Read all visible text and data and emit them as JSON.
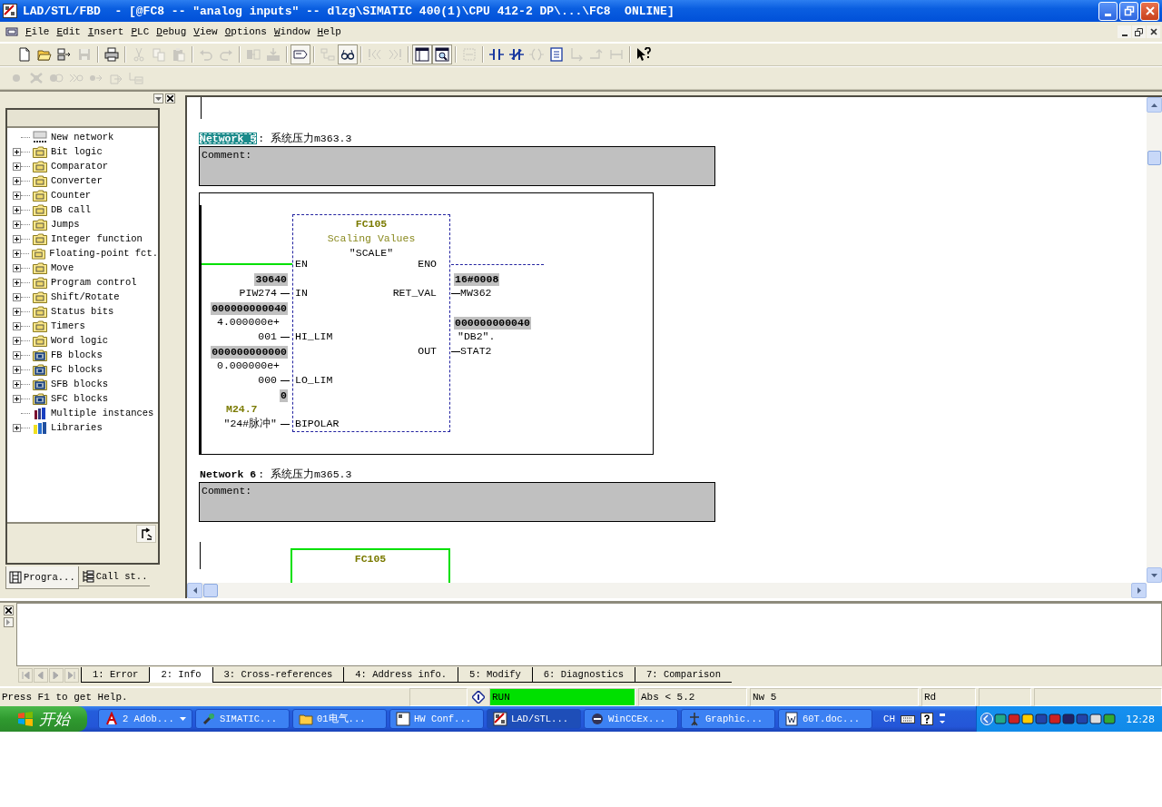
{
  "window": {
    "title": "LAD/STL/FBD  - [@FC8 -- ″analog inputs″ -- dlzg\\SIMATIC 400(1)\\CPU 412-2 DP\\...\\FC8  ONLINE]"
  },
  "menu": [
    "File",
    "Edit",
    "Insert",
    "PLC",
    "Debug",
    "View",
    "Options",
    "Window",
    "Help"
  ],
  "toolbar": [
    {
      "kind": "new",
      "disabled": false,
      "pressed": false
    },
    {
      "kind": "open",
      "disabled": false,
      "pressed": false
    },
    {
      "kind": "nodes",
      "disabled": false,
      "pressed": false
    },
    {
      "kind": "save",
      "disabled": true,
      "pressed": false
    },
    {
      "kind": "separator"
    },
    {
      "kind": "print",
      "disabled": false,
      "pressed": false
    },
    {
      "kind": "separator"
    },
    {
      "kind": "cut",
      "disabled": true,
      "pressed": false
    },
    {
      "kind": "copy",
      "disabled": true,
      "pressed": false
    },
    {
      "kind": "paste",
      "disabled": true,
      "pressed": false
    },
    {
      "kind": "separator"
    },
    {
      "kind": "undo",
      "disabled": true,
      "pressed": false
    },
    {
      "kind": "redo",
      "disabled": true,
      "pressed": false
    },
    {
      "kind": "separator"
    },
    {
      "kind": "upload",
      "disabled": true,
      "pressed": false
    },
    {
      "kind": "download",
      "disabled": true,
      "pressed": false
    },
    {
      "kind": "separator"
    },
    {
      "kind": "frame",
      "disabled": false,
      "pressed": true
    },
    {
      "kind": "separator"
    },
    {
      "kind": "network",
      "disabled": true,
      "pressed": false
    },
    {
      "kind": "glasses",
      "disabled": false,
      "pressed": true
    },
    {
      "kind": "separator"
    },
    {
      "kind": "prev",
      "disabled": true,
      "pressed": false
    },
    {
      "kind": "next",
      "disabled": true,
      "pressed": false
    },
    {
      "kind": "separator"
    },
    {
      "kind": "panel",
      "disabled": false,
      "pressed": true
    },
    {
      "kind": "zoom",
      "disabled": false,
      "pressed": true
    },
    {
      "kind": "separator"
    },
    {
      "kind": "newnet",
      "disabled": true,
      "pressed": false
    },
    {
      "kind": "separator"
    },
    {
      "kind": "no",
      "disabled": false,
      "pressed": false
    },
    {
      "kind": "nc",
      "disabled": false,
      "pressed": false
    },
    {
      "kind": "coil",
      "disabled": true,
      "pressed": false
    },
    {
      "kind": "box",
      "disabled": false,
      "pressed": false
    },
    {
      "kind": "bopen",
      "disabled": true,
      "pressed": false
    },
    {
      "kind": "bclose",
      "disabled": true,
      "pressed": false
    },
    {
      "kind": "conn",
      "disabled": true,
      "pressed": false
    },
    {
      "kind": "separator"
    },
    {
      "kind": "help",
      "disabled": false,
      "pressed": false
    }
  ],
  "debug_toolbar": [
    {
      "kind": "dot",
      "disabled": true
    },
    {
      "kind": "xdot",
      "disabled": true
    },
    {
      "kind": "dots",
      "disabled": true
    },
    {
      "kind": "ffwd",
      "disabled": true
    },
    {
      "kind": "step",
      "disabled": true
    },
    {
      "kind": "exit",
      "disabled": true
    },
    {
      "kind": "cursor",
      "disabled": true
    }
  ],
  "sidebar": {
    "items": [
      {
        "kind": "network",
        "label": "New network"
      },
      {
        "kind": "folder",
        "label": "Bit logic",
        "expanded": false
      },
      {
        "kind": "folder",
        "label": "Comparator",
        "expanded": false
      },
      {
        "kind": "folder",
        "label": "Converter",
        "expanded": false
      },
      {
        "kind": "folder",
        "label": "Counter",
        "expanded": false
      },
      {
        "kind": "folder",
        "label": "DB call",
        "expanded": false
      },
      {
        "kind": "folder",
        "label": "Jumps",
        "expanded": false
      },
      {
        "kind": "folder",
        "label": "Integer function",
        "expanded": false
      },
      {
        "kind": "folder",
        "label": "Floating-point fct.",
        "expanded": false
      },
      {
        "kind": "folder",
        "label": "Move",
        "expanded": false
      },
      {
        "kind": "folder",
        "label": "Program control",
        "expanded": false
      },
      {
        "kind": "folder",
        "label": "Shift/Rotate",
        "expanded": false
      },
      {
        "kind": "folder",
        "label": "Status bits",
        "expanded": false
      },
      {
        "kind": "folder",
        "label": "Timers",
        "expanded": false
      },
      {
        "kind": "folder",
        "label": "Word logic",
        "expanded": false
      },
      {
        "kind": "block-folder",
        "label": "FB blocks",
        "expanded": false
      },
      {
        "kind": "block-folder",
        "label": "FC blocks",
        "expanded": false
      },
      {
        "kind": "block-folder",
        "label": "SFB blocks",
        "expanded": false
      },
      {
        "kind": "block-folder",
        "label": "SFC blocks",
        "expanded": false
      },
      {
        "kind": "instances",
        "label": "Multiple instances"
      },
      {
        "kind": "library",
        "label": "Libraries",
        "expanded": false
      }
    ],
    "tabs": [
      {
        "label": "Progra...",
        "selected": true
      },
      {
        "label": "Call st..",
        "selected": false
      }
    ]
  },
  "networks": [
    {
      "label": "Network 5",
      "selected": true,
      "title": ": 系统压力m363.3",
      "comment": "Comment:",
      "block": {
        "number": "FC105",
        "name": "Scaling Values",
        "symbol": "″SCALE″",
        "inputs": [
          {
            "pin": "EN",
            "powered": true
          },
          {
            "pin": "IN",
            "value": "30640",
            "operand": [
              "PIW274"
            ]
          },
          {
            "pin": "HI_LIM",
            "value": "000000000040",
            "operand": [
              "4.000000e+",
              "001"
            ]
          },
          {
            "pin": "LO_LIM",
            "value": "000000000000",
            "operand": [
              "0.000000e+",
              "000"
            ]
          },
          {
            "pin": "BIPOLAR",
            "value": "0",
            "address": "M24.7",
            "operand": [
              "″24#脉冲″"
            ]
          }
        ],
        "outputs": [
          {
            "pin": "ENO",
            "powered": false
          },
          {
            "pin": "RET_VAL",
            "value": "16#0008",
            "operand": [
              "MW362"
            ]
          },
          {
            "pin": "OUT",
            "value": "000000000040",
            "operand": [
              "″DB2″.",
              "STAT2"
            ]
          }
        ]
      }
    },
    {
      "label": "Network 6",
      "selected": false,
      "title": ": 系统压力m365.3",
      "comment": "Comment:",
      "block": {
        "number": "FC105",
        "powered": true
      }
    }
  ],
  "output_tabs": [
    {
      "label": "1: Error",
      "selected": false
    },
    {
      "label": "2: Info",
      "selected": true
    },
    {
      "label": "3: Cross-references",
      "selected": false
    },
    {
      "label": "4: Address info.",
      "selected": false
    },
    {
      "label": "5: Modify",
      "selected": false
    },
    {
      "label": "6: Diagnostics",
      "selected": false
    },
    {
      "label": "7: Comparison",
      "selected": false
    }
  ],
  "status_bar": {
    "help": "Press F1 to get Help.",
    "mode": "RUN",
    "running": true,
    "position": "Abs < 5.2",
    "network": "Nw 5",
    "access": "Rd"
  },
  "taskbar": {
    "start": "开始",
    "tasks": [
      {
        "label": "2 Adob...",
        "selected": false,
        "group": true
      },
      {
        "label": "SIMATIC...",
        "selected": false
      },
      {
        "label": "01电气...",
        "selected": false
      },
      {
        "label": "HW Conf...",
        "selected": false
      },
      {
        "label": "LAD/STL...",
        "selected": true
      },
      {
        "label": "WinCCEx...",
        "selected": false
      },
      {
        "label": "Graphic...",
        "selected": false
      },
      {
        "label": "60T.doc...",
        "selected": false
      }
    ],
    "language": "CH",
    "clock": "12:28"
  }
}
